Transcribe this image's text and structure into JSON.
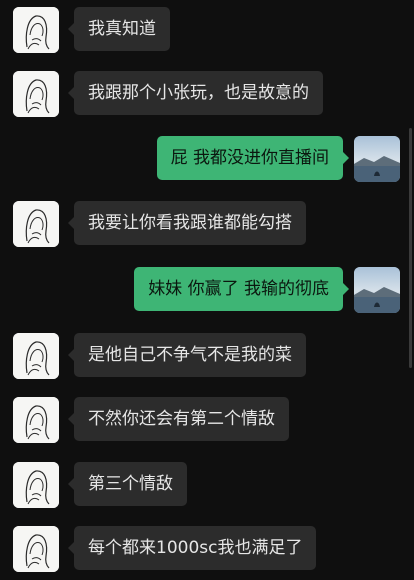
{
  "messages": [
    {
      "side": "left",
      "text": "我真知道"
    },
    {
      "side": "left",
      "text": "我跟那个小张玩，也是故意的"
    },
    {
      "side": "right",
      "text": "屁 我都没进你直播间"
    },
    {
      "side": "left",
      "text": "我要让你看我跟谁都能勾搭"
    },
    {
      "side": "right",
      "text": "妹妹 你赢了 我输的彻底"
    },
    {
      "side": "left",
      "text": "是他自己不争气不是我的菜"
    },
    {
      "side": "left",
      "text": "不然你还会有第二个情敌"
    },
    {
      "side": "left",
      "text": "第三个情敌"
    },
    {
      "side": "left",
      "text": "每个都来1000sc我也满足了"
    }
  ],
  "icons": {
    "left_avatar": "sketch-girl-avatar-icon",
    "right_avatar": "lake-landscape-avatar-icon"
  },
  "colors": {
    "background": "#0f0f0f",
    "incoming_bubble": "#2c2c2c",
    "outgoing_bubble": "#3eb575",
    "incoming_text": "#e6e6e6",
    "outgoing_text": "#0b170f"
  }
}
